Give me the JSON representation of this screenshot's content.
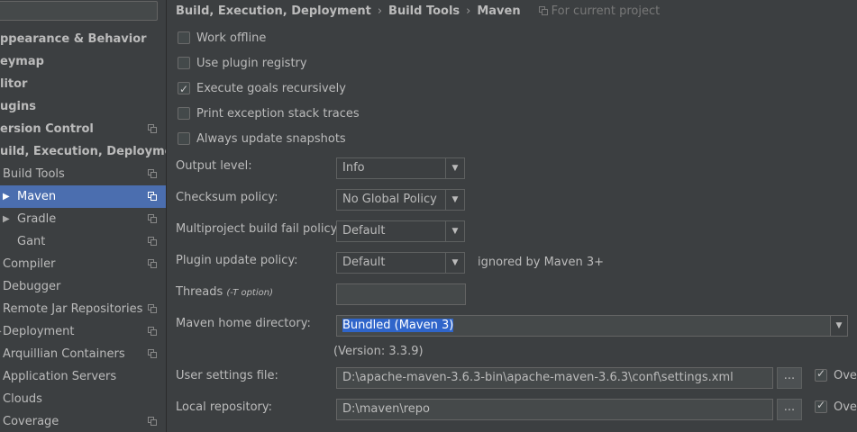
{
  "sidebar": {
    "items": [
      {
        "label": "ppearance & Behavior"
      },
      {
        "label": "eymap"
      },
      {
        "label": "litor"
      },
      {
        "label": "ugins"
      },
      {
        "label": "ersion Control"
      },
      {
        "label": "uild, Execution, Deployment"
      },
      {
        "label": "Build Tools"
      },
      {
        "label": "Maven"
      },
      {
        "label": "Gradle"
      },
      {
        "label": "Gant"
      },
      {
        "label": "Compiler"
      },
      {
        "label": "Debugger"
      },
      {
        "label": "Remote Jar Repositories"
      },
      {
        "label": "Deployment"
      },
      {
        "label": "Arquillian Containers"
      },
      {
        "label": "Application Servers"
      },
      {
        "label": "Clouds"
      },
      {
        "label": "Coverage"
      }
    ]
  },
  "breadcrumb": {
    "part1": "Build, Execution, Deployment",
    "part2": "Build Tools",
    "part3": "Maven",
    "separator": "›",
    "scope": "For current project"
  },
  "checkboxes": [
    {
      "label": "Work offline",
      "checked": false
    },
    {
      "label": "Use plugin registry",
      "checked": false
    },
    {
      "label": "Execute goals recursively",
      "checked": true
    },
    {
      "label": "Print exception stack traces",
      "checked": false
    },
    {
      "label": "Always update snapshots",
      "checked": false
    }
  ],
  "form": {
    "output_level": {
      "label": "Output level:",
      "value": "Info"
    },
    "checksum_policy": {
      "label": "Checksum policy:",
      "value": "No Global Policy"
    },
    "multiproject_fail": {
      "label": "Multiproject build fail policy:",
      "value": "Default"
    },
    "plugin_update": {
      "label": "Plugin update policy:",
      "value": "Default",
      "hint": "ignored by Maven 3+"
    },
    "threads": {
      "label": "Threads",
      "hint": "(-T option)",
      "value": ""
    },
    "maven_home": {
      "label": "Maven home directory:",
      "value": "Bundled (Maven 3)",
      "version": "(Version: 3.3.9)"
    },
    "user_settings": {
      "label": "User settings file:",
      "value": "D:\\apache-maven-3.6.3-bin\\apache-maven-3.6.3\\conf\\settings.xml",
      "override_label": "Ove",
      "override_checked": true
    },
    "local_repo": {
      "label": "Local repository:",
      "value": "D:\\maven\\repo",
      "override_label": "Ove",
      "override_checked": true
    },
    "browse_label": "..."
  },
  "colors": {
    "selection": "#4b6eaf",
    "background": "#3c3f41",
    "text": "#bbbbbb"
  }
}
